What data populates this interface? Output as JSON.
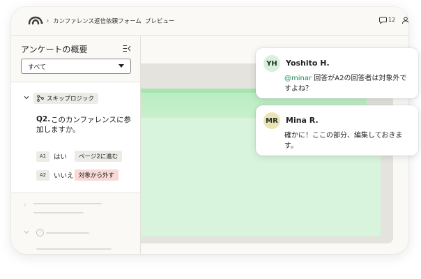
{
  "header": {
    "survey_title": "カンファレンス返信依頼フォーム",
    "preview_label": "プレビュー",
    "comment_count": "12",
    "icons": [
      "logo-icon",
      "chevron-right-icon",
      "comment-icon",
      "user-icon"
    ]
  },
  "sidebar": {
    "title": "アンケートの概要",
    "filter_value": "すべて",
    "logic_badge": "スキップロジック",
    "question_number": "Q2.",
    "question_text": "このカンファレンスに参加しますか。",
    "answers": [
      {
        "tag": "A1",
        "label": "はい",
        "action": "ページ2に進む"
      },
      {
        "tag": "A2",
        "label": "いいえ",
        "action": "対象から外す"
      }
    ],
    "question_placeholder_icon": "?"
  },
  "comments": [
    {
      "initials": "YH",
      "name": "Yoshito H.",
      "mention": "@minar",
      "message": " 回答がA2の回答者は対象外ですよね？",
      "avatar_color": "#d6f1dc"
    },
    {
      "initials": "MR",
      "name": "Mina R.",
      "mention": "",
      "message": "確かに！ここの部分、編集しておきます。",
      "avatar_color": "#ece3b4"
    }
  ],
  "colors": {
    "accent_green": "#1e8a55",
    "preview_green": "#b7ecc0",
    "exclude_red": "#f7d9d6"
  }
}
